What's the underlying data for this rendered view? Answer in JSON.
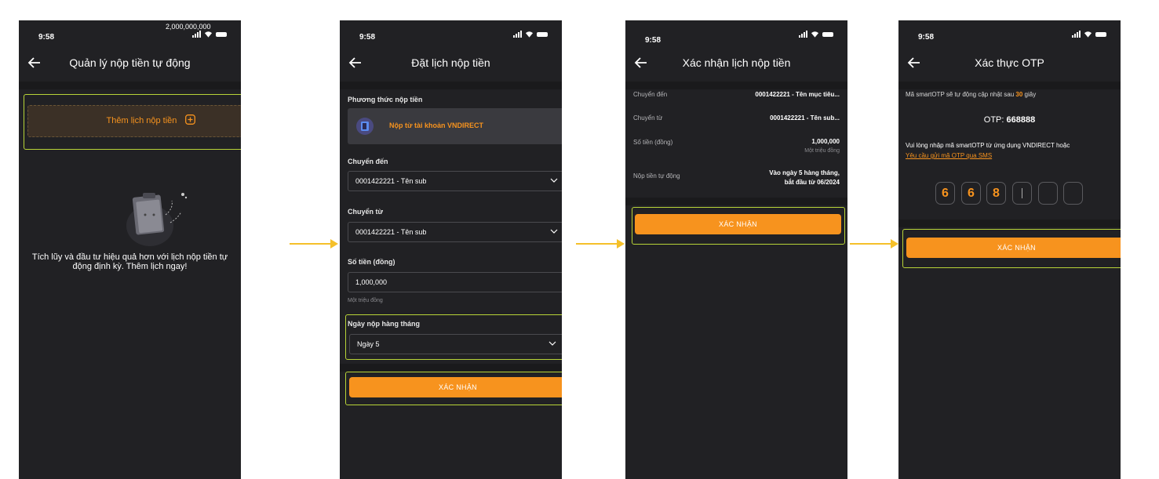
{
  "status_bar": {
    "time": "9:58"
  },
  "floating_number": "2,000,000,000",
  "screen1": {
    "title": "Quản lý nộp tiền tự động",
    "add_button_label": "Thêm lịch nộp tiền",
    "empty_message_line1": "Tích lũy và đầu tư hiệu quả hơn với lịch nộp tiền tự",
    "empty_message_line2": "động định kỳ. Thêm lịch ngay!"
  },
  "screen2": {
    "title": "Đặt lịch nộp tiền",
    "method_label": "Phương thức nộp tiền",
    "method_value": "Nộp từ tài khoản VNDIRECT",
    "to_label": "Chuyển đến",
    "to_value": "0001422221 - Tên sub",
    "from_label": "Chuyển từ",
    "from_value": "0001422221 - Tên sub",
    "amount_label": "Số tiền (đồng)",
    "amount_value": "1,000,000",
    "amount_words": "Một triệu đồng",
    "day_label": "Ngày nộp hàng tháng",
    "day_value": "Ngày 5",
    "confirm_label": "XÁC NHẬN"
  },
  "screen3": {
    "title": "Xác nhận lịch nộp tiền",
    "rows": [
      {
        "label": "Chuyển đến",
        "value": "0001422221 - Tên mục tiêu..."
      },
      {
        "label": "Chuyển từ",
        "value": "0001422221 - Tên sub..."
      },
      {
        "label": "Số tiền (đồng)",
        "value": "1,000,000",
        "sub": "Một triệu đồng"
      },
      {
        "label": "Nộp tiền tự động",
        "value": "Vào ngày 5 hàng tháng,",
        "value2": "bắt đầu từ 06/2024"
      }
    ],
    "confirm_label": "XÁC NHẬN"
  },
  "screen4": {
    "title": "Xác thực OTP",
    "refresh_prefix": "Mã smartOTP sẽ tự động cập nhật sau ",
    "refresh_seconds": "30",
    "refresh_suffix": " giây",
    "otp_label": "OTP: ",
    "otp_value": "668888",
    "instruction": "Vui lòng nhập mã smartOTP từ ứng dụng VNDIRECT hoặc",
    "sms_link": "Yêu cầu gửi mã OTP qua SMS",
    "digits": [
      "6",
      "6",
      "8",
      "",
      "",
      ""
    ],
    "confirm_label": "XÁC NHẬN"
  },
  "colors": {
    "accent": "#f7931e",
    "highlight": "#b8d438",
    "background": "#212124",
    "arrow": "#f5c02a"
  }
}
